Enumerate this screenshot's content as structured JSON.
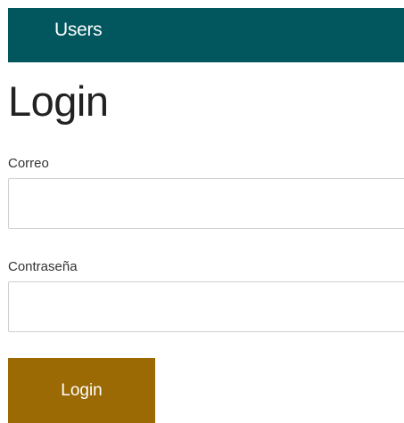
{
  "navbar": {
    "brand": "Users",
    "color": "#02565e"
  },
  "page": {
    "title": "Login"
  },
  "form": {
    "email": {
      "label": "Correo",
      "value": "",
      "placeholder": ""
    },
    "password": {
      "label": "Contraseña",
      "value": "",
      "placeholder": ""
    },
    "submit_label": "Login",
    "submit_color": "#9b6a04"
  }
}
